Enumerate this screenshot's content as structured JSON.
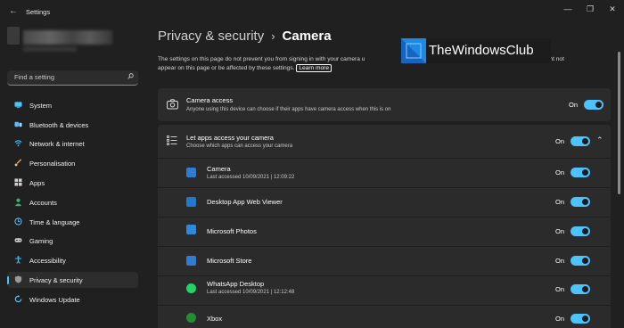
{
  "window": {
    "title": "Settings",
    "back": "←",
    "minimize": "—",
    "maximize": "❐",
    "close": "✕"
  },
  "search": {
    "placeholder": "Find a setting"
  },
  "sidebar": {
    "items": [
      {
        "label": "System",
        "icon": "system-icon",
        "color": "#4cc2ff"
      },
      {
        "label": "Bluetooth & devices",
        "icon": "bluetooth-icon",
        "color": "#4cc2ff"
      },
      {
        "label": "Network & internet",
        "icon": "wifi-icon",
        "color": "#4cc2ff"
      },
      {
        "label": "Personalisation",
        "icon": "brush-icon",
        "color": "#f5a05a"
      },
      {
        "label": "Apps",
        "icon": "apps-icon",
        "color": "#cfcfcf"
      },
      {
        "label": "Accounts",
        "icon": "account-icon",
        "color": "#33b573"
      },
      {
        "label": "Time & language",
        "icon": "globe-clock-icon",
        "color": "#4cc2ff"
      },
      {
        "label": "Gaming",
        "icon": "gamepad-icon",
        "color": "#cfcfcf"
      },
      {
        "label": "Accessibility",
        "icon": "accessibility-icon",
        "color": "#4cc2ff"
      },
      {
        "label": "Privacy & security",
        "icon": "shield-icon",
        "color": "#9a9a9a",
        "active": true
      },
      {
        "label": "Windows Update",
        "icon": "update-icon",
        "color": "#4cc2ff"
      }
    ]
  },
  "header": {
    "parent": "Privacy & security",
    "separator": "›",
    "current": "Camera"
  },
  "info": {
    "text1": "The settings on this page do not prevent you from signing in with your camera u",
    "text2": "ktop apps might not",
    "text3": "appear on this page or be affected by these settings.",
    "link": "Learn more"
  },
  "watermark": {
    "text": "TheWindowsClub"
  },
  "camera_access": {
    "title": "Camera access",
    "subtitle": "Anyone using this device can choose if their apps have camera access when this is on",
    "state": "On",
    "icon": "camera-icon"
  },
  "apps_access": {
    "title": "Let apps access your camera",
    "subtitle": "Choose which apps can access your camera",
    "state": "On",
    "icon": "list-icon",
    "chevron": "⌃"
  },
  "apps": [
    {
      "name": "Camera",
      "sub": "Last accessed 10/09/2021  |  12:09:22",
      "state": "On",
      "icon": "camera-app-icon",
      "color": "#2d7dd2"
    },
    {
      "name": "Desktop App Web Viewer",
      "sub": "",
      "state": "On",
      "icon": "web-viewer-icon",
      "color": "#1f78d1"
    },
    {
      "name": "Microsoft Photos",
      "sub": "",
      "state": "On",
      "icon": "photos-icon",
      "color": "#2b8ad9"
    },
    {
      "name": "Microsoft Store",
      "sub": "",
      "state": "On",
      "icon": "store-icon",
      "color": "#2d7dd2"
    },
    {
      "name": "WhatsApp Desktop",
      "sub": "Last accessed 10/09/2021  |  12:12:48",
      "state": "On",
      "icon": "whatsapp-icon",
      "color": "#25d366"
    },
    {
      "name": "Xbox",
      "sub": "",
      "state": "On",
      "icon": "xbox-icon",
      "color": "#1f8f2f"
    }
  ],
  "colors": {
    "accent": "#4cc2ff",
    "background": "#202020",
    "card": "#2b2b2b"
  }
}
